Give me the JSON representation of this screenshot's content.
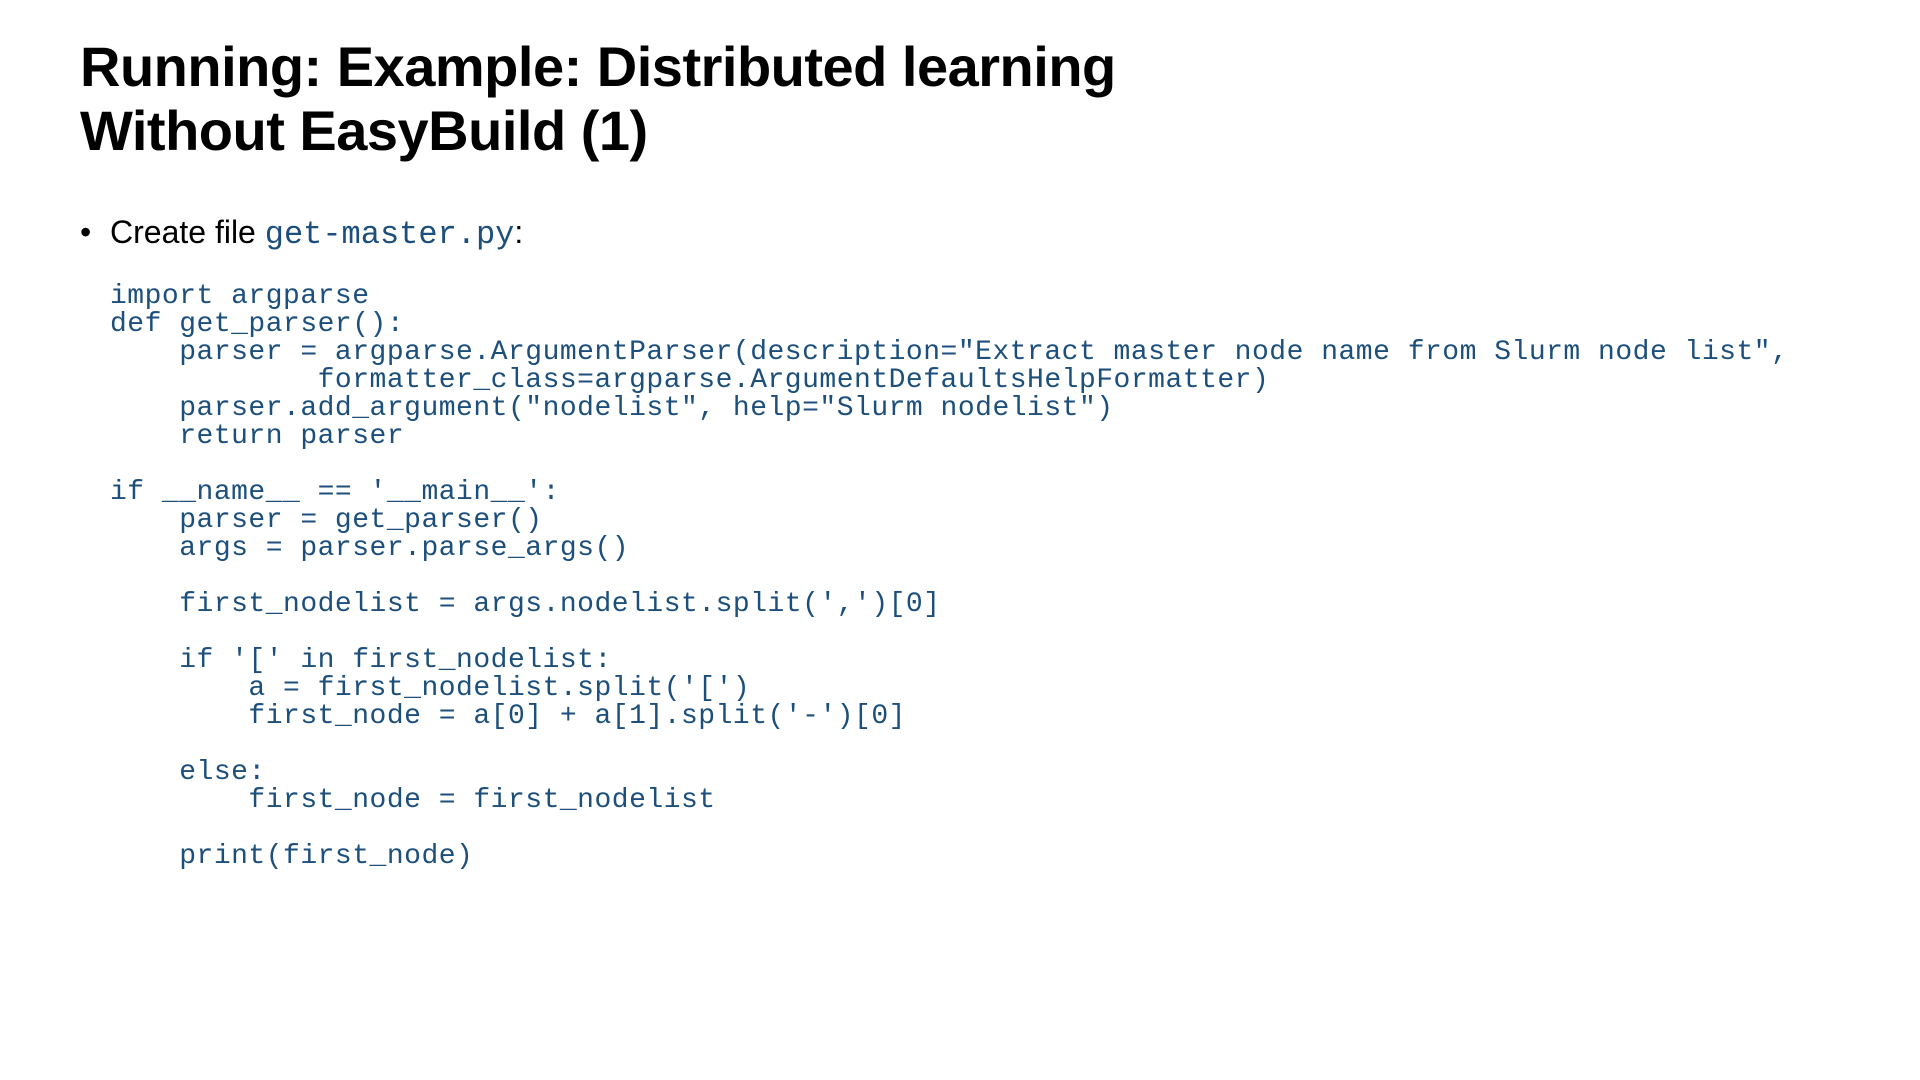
{
  "title_line1": "Running: Example: Distributed learning",
  "title_line2": "Without EasyBuild (1)",
  "bullet_prefix": "Create file ",
  "filename": "get-master.py",
  "bullet_suffix": ":",
  "code": "import argparse\ndef get_parser():\n    parser = argparse.ArgumentParser(description=\"Extract master node name from Slurm node list\",\n            formatter_class=argparse.ArgumentDefaultsHelpFormatter)\n    parser.add_argument(\"nodelist\", help=\"Slurm nodelist\")\n    return parser\n\nif __name__ == '__main__':\n    parser = get_parser()\n    args = parser.parse_args()\n\n    first_nodelist = args.nodelist.split(',')[0]\n\n    if '[' in first_nodelist:\n        a = first_nodelist.split('[')\n        first_node = a[0] + a[1].split('-')[0]\n\n    else:\n        first_node = first_nodelist\n\n    print(first_node)"
}
